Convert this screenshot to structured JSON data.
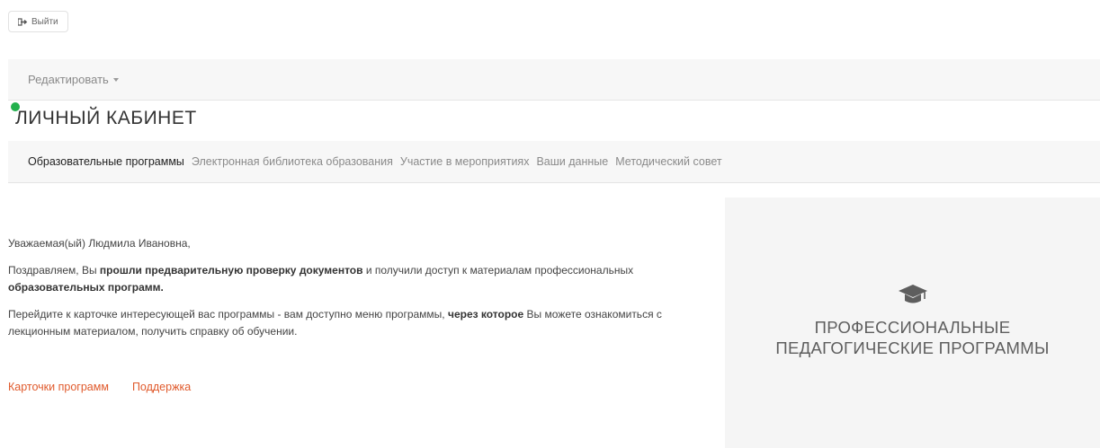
{
  "header": {
    "logout_label": "Выйти",
    "logout_icon": "logout-icon"
  },
  "edit_bar": {
    "dropdown_label": "Редактировать"
  },
  "page": {
    "title": "ЛИЧНЫЙ КАБИНЕТ",
    "status_color": "#22b04c"
  },
  "nav": {
    "items": [
      {
        "label": "Образовательные программы",
        "active": true
      },
      {
        "label": "Электронная библиотека образования",
        "active": false
      },
      {
        "label": "Участие в мероприятиях",
        "active": false
      },
      {
        "label": "Ваши данные",
        "active": false
      },
      {
        "label": "Методический совет",
        "active": false
      }
    ]
  },
  "content": {
    "greeting": "Уважаемая(ый) Людмила Ивановна,",
    "p1_part1": "Поздравляем, Вы ",
    "p1_bold1": "прошли предварительную проверку документов",
    "p1_part2": " и получили доступ к материалам профессиональных ",
    "p1_bold2": "образовательных программ.",
    "p2_part1": "Перейдите к карточке интересующей вас программы - вам доступно меню программы, ",
    "p2_bold": "через которое",
    "p2_part2": " Вы можете ознакомиться с лекционным материалом, получить справку об обучении."
  },
  "links": {
    "cards": "Карточки программ",
    "support": "Поддержка"
  },
  "side_panel": {
    "icon": "graduation-cap-icon",
    "title_line1": "ПРОФЕССИОНАЛЬНЫЕ",
    "title_line2": "ПЕДАГОГИЧЕСКИЕ ПРОГРАММЫ"
  },
  "colors": {
    "accent_link": "#e05a2c",
    "panel_bg": "#f5f5f5"
  }
}
